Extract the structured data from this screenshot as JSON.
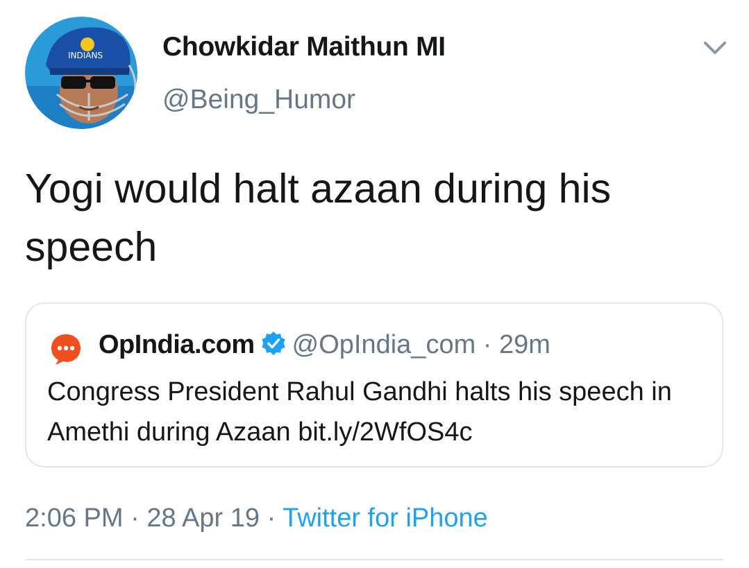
{
  "author": {
    "display_name": "Chowkidar Maithun MI",
    "handle": "@Being_Humor",
    "avatar_icon": "cricket-helmet-avatar"
  },
  "menu": {
    "icon": "chevron-down-icon"
  },
  "tweet": {
    "text": "Yogi would halt azaan during his speech"
  },
  "quoted_tweet": {
    "logo_icon": "opindia-chat-bubble-icon",
    "display_name": "OpIndia.com",
    "verified_icon": "verified-badge-icon",
    "handle": "@OpIndia_com",
    "separator": "·",
    "time": "29m",
    "text": "Congress President Rahul Gandhi halts his speech in Amethi during Azaan bit.ly/2WfOS4c"
  },
  "meta": {
    "time": "2:06 PM",
    "separator": "·",
    "date": "28 Apr 19",
    "source": "Twitter for iPhone"
  },
  "colors": {
    "text_primary": "#14171a",
    "text_secondary": "#657786",
    "accent": "#1da1f2",
    "border": "#e1e8ed",
    "opindia_orange": "#f0501e"
  }
}
